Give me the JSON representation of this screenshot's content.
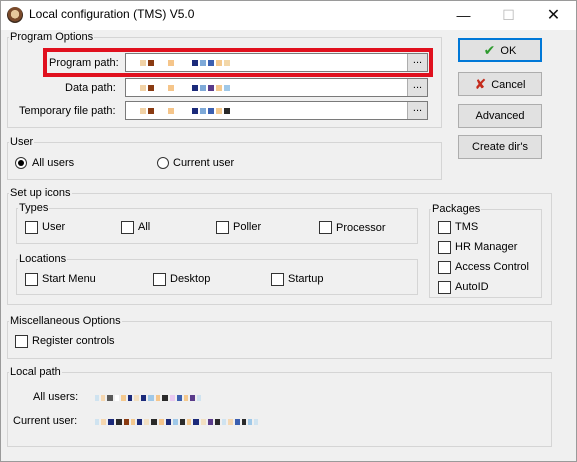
{
  "window": {
    "title": "Local configuration (TMS) V5.0",
    "minimize": "—",
    "maximize": "☐",
    "close": "✕"
  },
  "program_options": {
    "legend": "Program Options",
    "program_path_label": "Program path:",
    "data_path_label": "Data path:",
    "temp_path_label": "Temporary file path:",
    "browse": "..."
  },
  "buttons": {
    "ok": "OK",
    "cancel": "Cancel",
    "advanced": "Advanced",
    "create_dirs": "Create dir's"
  },
  "user": {
    "legend": "User",
    "all_users": "All users",
    "current_user": "Current user",
    "selected": "all_users"
  },
  "setup_icons": {
    "legend": "Set up icons",
    "types": {
      "legend": "Types",
      "items": [
        "User",
        "All",
        "Poller",
        "Processor"
      ]
    },
    "locations": {
      "legend": "Locations",
      "items": [
        "Start Menu",
        "Desktop",
        "Startup"
      ]
    },
    "packages": {
      "legend": "Packages",
      "items": [
        "TMS",
        "HR Manager",
        "Access Control",
        "AutoID"
      ]
    }
  },
  "misc": {
    "legend": "Miscellaneous Options",
    "register_controls": "Register controls"
  },
  "local_path": {
    "legend": "Local path",
    "all_users_label": "All users:",
    "current_user_label": "Current user:"
  },
  "colors": {
    "highlight": "#e0101e",
    "ok_check": "#2e9a2e",
    "cancel_x": "#c42b1c",
    "focus": "#0078d7"
  }
}
